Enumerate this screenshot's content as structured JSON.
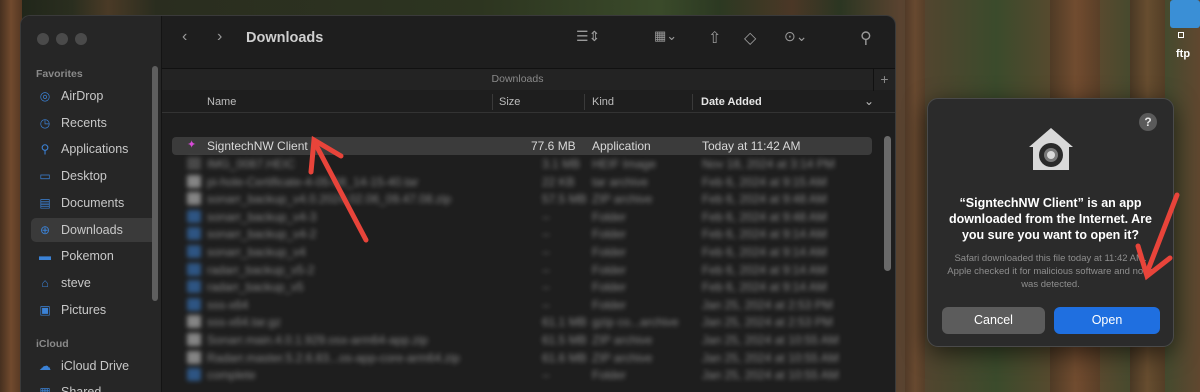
{
  "desktop": {
    "ftp_label": "ftp"
  },
  "finder": {
    "title": "Downloads",
    "path_label": "Downloads",
    "sidebar": {
      "favorites_heading": "Favorites",
      "icloud_heading": "iCloud",
      "items": [
        {
          "label": "AirDrop",
          "icon": "airdrop-icon",
          "glyph": "◎"
        },
        {
          "label": "Recents",
          "icon": "clock-icon",
          "glyph": "◷"
        },
        {
          "label": "Applications",
          "icon": "applications-icon",
          "glyph": "⚲"
        },
        {
          "label": "Desktop",
          "icon": "desktop-icon",
          "glyph": "▭"
        },
        {
          "label": "Documents",
          "icon": "document-icon",
          "glyph": "▤"
        },
        {
          "label": "Downloads",
          "icon": "downloads-icon",
          "glyph": "⊕"
        },
        {
          "label": "Pokemon",
          "icon": "folder-icon",
          "glyph": "▬"
        },
        {
          "label": "steve",
          "icon": "home-icon",
          "glyph": "⌂"
        },
        {
          "label": "Pictures",
          "icon": "pictures-icon",
          "glyph": "▣"
        }
      ],
      "icloud_items": [
        {
          "label": "iCloud Drive",
          "icon": "cloud-icon",
          "glyph": "☁"
        },
        {
          "label": "Shared",
          "icon": "shared-icon",
          "glyph": "▦"
        }
      ]
    },
    "columns": {
      "name": "Name",
      "size": "Size",
      "kind": "Kind",
      "date": "Date Added"
    },
    "selected_file": {
      "name": "SigntechNW Client",
      "size": "77.6 MB",
      "kind": "Application",
      "date": "Today at 11:42 AM"
    },
    "blurred_rows": [
      {
        "name": "IMG_0087.HEIC",
        "size": "3.1 MB",
        "kind": "HEIF Image",
        "date": "Nov 18, 2024 at 3:14 PM"
      },
      {
        "name": "pi-hole-Certificate-4-05-08_14-15-40.tar",
        "size": "22 KB",
        "kind": "tar archive",
        "date": "Feb 6, 2024 at 9:15 AM"
      },
      {
        "name": "sonarr_backup_v4.0.2024.02.06_09.47.08.zip",
        "size": "57.5 MB",
        "kind": "ZIP archive",
        "date": "Feb 6, 2024 at 9:48 AM"
      },
      {
        "name": "sonarr_backup_v4-3",
        "size": "--",
        "kind": "Folder",
        "date": "Feb 6, 2024 at 9:48 AM"
      },
      {
        "name": "sonarr_backup_v4-2",
        "size": "--",
        "kind": "Folder",
        "date": "Feb 6, 2024 at 9:14 AM"
      },
      {
        "name": "sonarr_backup_v4",
        "size": "--",
        "kind": "Folder",
        "date": "Feb 6, 2024 at 9:14 AM"
      },
      {
        "name": "radarr_backup_v5-2",
        "size": "--",
        "kind": "Folder",
        "date": "Feb 6, 2024 at 9:14 AM"
      },
      {
        "name": "radarr_backup_v5",
        "size": "--",
        "kind": "Folder",
        "date": "Feb 6, 2024 at 9:14 AM"
      },
      {
        "name": "sss-x64",
        "size": "--",
        "kind": "Folder",
        "date": "Jan 25, 2024 at 2:53 PM"
      },
      {
        "name": "sss-x64.tar.gz",
        "size": "61.1 MB",
        "kind": "gzip co...archive",
        "date": "Jan 25, 2024 at 2:53 PM"
      },
      {
        "name": "Sonarr.main.4.0.1.929.osx-arm64-app.zip",
        "size": "61.5 MB",
        "kind": "ZIP archive",
        "date": "Jan 25, 2024 at 10:55 AM"
      },
      {
        "name": "Radarr.master.5.2.6.83...os-app-core-arm64.zip",
        "size": "61.6 MB",
        "kind": "ZIP archive",
        "date": "Jan 25, 2024 at 10:55 AM"
      },
      {
        "name": "complete",
        "size": "--",
        "kind": "Folder",
        "date": "Jan 25, 2024 at 10:55 AM"
      }
    ]
  },
  "dialog": {
    "title": "“SigntechNW Client” is an app downloaded from the Internet. Are you sure you want to open it?",
    "body": "Safari downloaded this file today at 11:42 AM. Apple checked it for malicious software and none was detected.",
    "help_label": "?",
    "cancel_label": "Cancel",
    "open_label": "Open"
  },
  "colors": {
    "accent": "#1f6fe0",
    "annotation_arrow": "#e8443a",
    "folder": "#3b82d6"
  }
}
